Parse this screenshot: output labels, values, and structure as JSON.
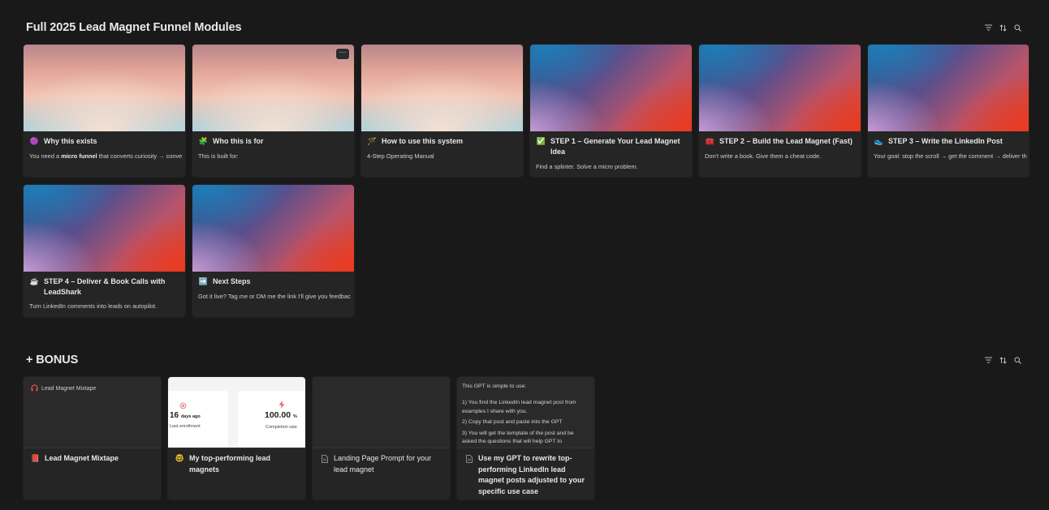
{
  "sections": [
    {
      "title": "Full 2025 Lead Magnet Funnel Modules"
    },
    {
      "title": "+ BONUS"
    }
  ],
  "toolbar_icons": [
    "filter-icon",
    "sort-icon",
    "search-icon"
  ],
  "colors": {
    "background": "#191919",
    "card": "#252525",
    "text": "#e6e6e6"
  },
  "modules": [
    {
      "emoji": "🟣",
      "title": "Why this exists",
      "desc_pre": "You need a ",
      "desc_bold": "micro funnel",
      "desc_post": " that converts curiosity → conve"
    },
    {
      "emoji": "🧩",
      "title": "Who this is for",
      "desc": "This is built for:"
    },
    {
      "emoji": "🪄",
      "title": "How to use this system",
      "desc": "4-Step Operating Manual"
    },
    {
      "emoji": "✅",
      "title": "STEP 1 – Generate Your Lead Magnet Idea",
      "desc": "Find a splinter. Solve a micro problem."
    },
    {
      "emoji": "🧰",
      "title": "STEP 2 – Build the Lead Magnet (Fast)",
      "desc": "Don't write a book. Give them a cheat code."
    },
    {
      "emoji": "👟",
      "title": "STEP 3 – Write the LinkedIn Post",
      "desc": "Your goal: stop the scroll → get the comment → deliver th"
    },
    {
      "emoji": "☕",
      "title": "STEP 4 – Deliver & Book Calls with LeadShark",
      "desc": "Turn LinkedIn comments into leads on autopilot."
    },
    {
      "emoji": "➡️",
      "title": "Next Steps",
      "desc": "Got it live? Tag me or DM me the link I'll give you feedbac"
    }
  ],
  "more_button": "···",
  "bonus": [
    {
      "emoji": "📕",
      "title": "Lead Magnet Mixtape",
      "cover_label": "Lead Magnet Mixtape",
      "cover_icon": "headphones-icon"
    },
    {
      "emoji": "🤓",
      "title": "My top-performing lead magnets",
      "stats": [
        {
          "icon": "target-icon",
          "value": "16",
          "unit": "days ago",
          "label": "Last enrollment"
        },
        {
          "icon": "lightning-icon",
          "value": "100.00",
          "unit": "%",
          "label": "Completion rate"
        }
      ]
    },
    {
      "emoji": "page-icon",
      "title": "Landing Page Prompt for your lead magnet"
    },
    {
      "emoji": "page-icon",
      "title": "Use my GPT to rewrite top-performing LinkedIn lead magnet posts adjusted to your specific use case",
      "cover_lines": [
        "This GPT is simple to use:",
        "",
        "1) You find the LinkedIn lead magnet post from examples I share with you.",
        "2) Copy that post and paste into the GPT",
        "3) You will get the template of the post and be asked the questions that will help GPT to"
      ]
    }
  ]
}
